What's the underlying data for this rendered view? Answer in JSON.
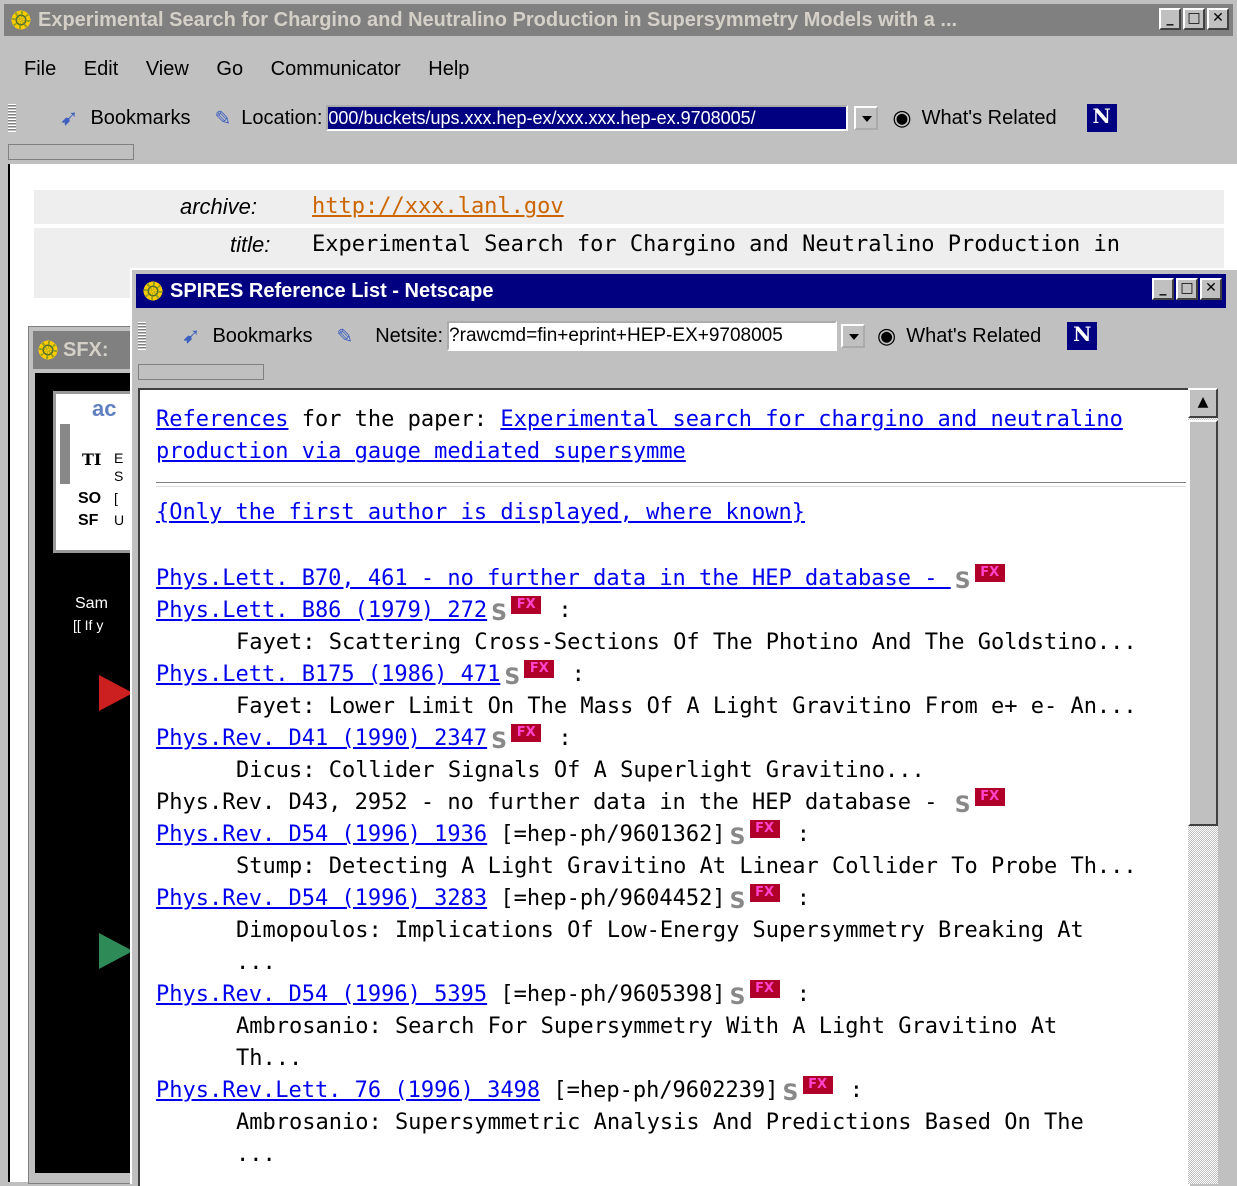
{
  "main_window": {
    "title": "Experimental Search for Chargino and Neutralino Production in Supersymmetry Models with a ...",
    "menu": [
      "File",
      "Edit",
      "View",
      "Go",
      "Communicator",
      "Help"
    ],
    "bookmarks_label": "Bookmarks",
    "location_label": "Location:",
    "location_value": "000/buckets/ups.xxx.hep-ex/xxx.xxx.hep-ex.9708005/",
    "whats_related": "What's Related",
    "archive_label": "archive:",
    "archive_value": "http://xxx.lanl.gov",
    "title_label": "title:",
    "title_value": "Experimental Search for Chargino and Neutralino Production in"
  },
  "sfx_window": {
    "title": "SFX:",
    "box_heading": "ac",
    "fields": [
      {
        "label": "TI",
        "value": "E"
      },
      {
        "label": "",
        "value": "S"
      },
      {
        "label": "SO",
        "value": "["
      },
      {
        "label": "SF",
        "value": "U"
      }
    ],
    "text1": "Sam",
    "text2": "[[ If y"
  },
  "spires_window": {
    "title": "SPIRES Reference List - Netscape",
    "bookmarks_label": "Bookmarks",
    "netsite_label": "Netsite:",
    "netsite_value": "?rawcmd=fin+eprint+HEP-EX+9708005",
    "whats_related": "What's Related",
    "references_link": "References",
    "for_paper_text": " for the paper: ",
    "paper_link_line1": "Experimental search for chargino and neutralino",
    "paper_link_line2": "production via gauge mediated supersymme",
    "first_author_note": "{Only the first author is displayed, where known}",
    "references": [
      {
        "link": "Phys.Lett. B70, 461 - no further data in the HEP database - ",
        "extra": "",
        "colon": "",
        "desc": "",
        "linked": true
      },
      {
        "link": "Phys.Lett. B86 (1979) 272",
        "extra": "",
        "colon": " :",
        "desc": "Fayet: Scattering Cross-Sections Of The Photino And The Goldstino...",
        "linked": true
      },
      {
        "link": "Phys.Lett. B175 (1986) 471",
        "extra": "",
        "colon": " :",
        "desc": "Fayet: Lower Limit On The Mass Of A Light Gravitino From e+ e- An...",
        "linked": true
      },
      {
        "link": "Phys.Rev. D41 (1990) 2347",
        "extra": "",
        "colon": " :",
        "desc": "Dicus: Collider Signals Of A Superlight Gravitino...",
        "linked": true
      },
      {
        "link": "Phys.Rev. D43, 2952 - no further data in the HEP database - ",
        "extra": "",
        "colon": "",
        "desc": "",
        "linked": false
      },
      {
        "link": "Phys.Rev. D54 (1996) 1936",
        "extra": " [=hep-ph/9601362]",
        "colon": " :",
        "desc": "Stump: Detecting A Light Gravitino At Linear Collider To Probe Th...",
        "linked": true
      },
      {
        "link": "Phys.Rev. D54 (1996) 3283",
        "extra": " [=hep-ph/9604452]",
        "colon": " :",
        "desc": "Dimopoulos: Implications Of Low-Energy Supersymmetry Breaking At",
        "desc2": "...",
        "linked": true
      },
      {
        "link": "Phys.Rev. D54 (1996) 5395",
        "extra": " [=hep-ph/9605398]",
        "colon": " :",
        "desc": "Ambrosanio: Search For Supersymmetry With A Light Gravitino At",
        "desc2": "Th...",
        "linked": true
      },
      {
        "link": "Phys.Rev.Lett. 76 (1996) 3498",
        "extra": " [=hep-ph/9602239]",
        "colon": " :",
        "desc": "Ambrosanio: Supersymmetric Analysis And Predictions Based On The",
        "desc2": "...",
        "linked": true
      }
    ]
  },
  "colors": {
    "titlebar_active": "#000080",
    "titlebar_inactive": "#808080",
    "link": "#0000ee",
    "archive_link": "#cc6600"
  }
}
